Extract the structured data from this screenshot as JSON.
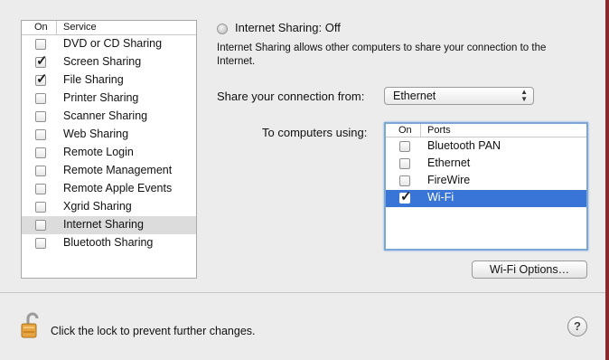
{
  "service_list": {
    "headers": {
      "on": "On",
      "service": "Service"
    },
    "items": [
      {
        "label": "DVD or CD Sharing",
        "checked": false
      },
      {
        "label": "Screen Sharing",
        "checked": true
      },
      {
        "label": "File Sharing",
        "checked": true
      },
      {
        "label": "Printer Sharing",
        "checked": false
      },
      {
        "label": "Scanner Sharing",
        "checked": false
      },
      {
        "label": "Web Sharing",
        "checked": false
      },
      {
        "label": "Remote Login",
        "checked": false
      },
      {
        "label": "Remote Management",
        "checked": false
      },
      {
        "label": "Remote Apple Events",
        "checked": false
      },
      {
        "label": "Xgrid Sharing",
        "checked": false
      },
      {
        "label": "Internet Sharing",
        "checked": false,
        "selected": true
      },
      {
        "label": "Bluetooth Sharing",
        "checked": false
      }
    ]
  },
  "detail": {
    "status_title": "Internet Sharing: Off",
    "description": "Internet Sharing allows other computers to share your connection to the Internet.",
    "share_from_label": "Share your connection from:",
    "share_from_value": "Ethernet",
    "to_computers_label": "To computers using:",
    "ports": {
      "headers": {
        "on": "On",
        "ports": "Ports"
      },
      "items": [
        {
          "label": "Bluetooth PAN",
          "checked": false
        },
        {
          "label": "Ethernet",
          "checked": false
        },
        {
          "label": "FireWire",
          "checked": false
        },
        {
          "label": "Wi-Fi",
          "checked": true,
          "selected": true
        }
      ]
    },
    "wifi_options_label": "Wi-Fi Options…"
  },
  "footer": {
    "lock_text": "Click the lock to prevent further changes.",
    "help_label": "?"
  },
  "colors": {
    "selection": "#3875d7",
    "list_highlight": "#dcdcdc",
    "focus_ring": "#7aa7d8"
  },
  "icons": {
    "lock": "lock-open-icon",
    "help": "help-icon",
    "status": "status-dot-icon"
  }
}
